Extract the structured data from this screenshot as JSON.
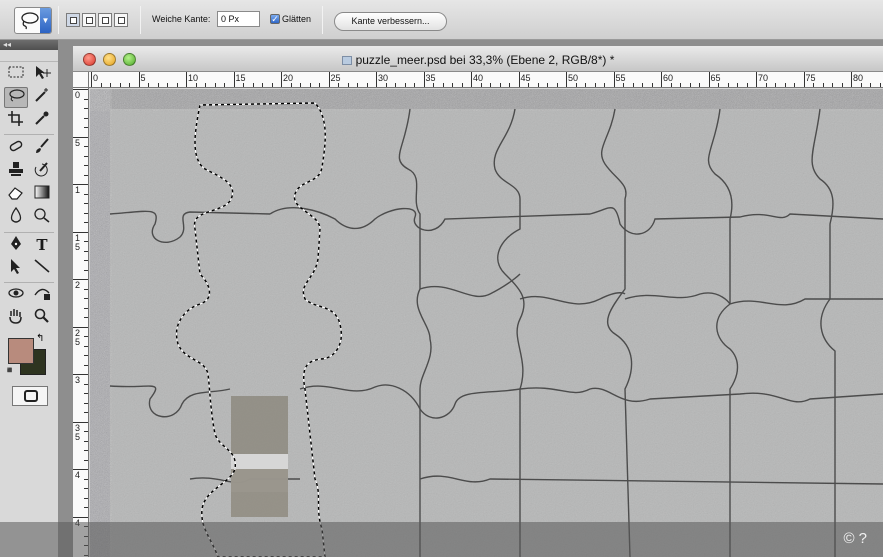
{
  "options_bar": {
    "tool_icon": "lasso-icon",
    "feather_label": "Weiche Kante:",
    "feather_value": "0 Px",
    "antialias_label": "Glätten",
    "antialias_checked": true,
    "refine_edge_label": "Kante verbessern..."
  },
  "toolbox": {
    "collapse_glyph": "◂◂",
    "tools": [
      "marquee-icon",
      "move-icon",
      "lasso-icon",
      "magic-wand-icon",
      "crop-icon",
      "eyedropper-icon",
      "healing-brush-icon",
      "brush-icon",
      "clone-stamp-icon",
      "history-brush-icon",
      "eraser-icon",
      "gradient-icon",
      "blur-icon",
      "dodge-icon",
      "pen-icon",
      "type-icon",
      "path-selection-icon",
      "line-icon",
      "3d-rotate-icon",
      "3d-orbit-icon",
      "hand-icon",
      "zoom-icon"
    ],
    "type_glyph": "T",
    "foreground_color": "#b88b7d",
    "background_color": "#2e3420"
  },
  "document": {
    "title": "puzzle_meer.psd bei 33,3% (Ebene 2, RGB/8*) *",
    "ruler_h_labels": [
      "0",
      "5",
      "10",
      "15",
      "20",
      "25",
      "30",
      "35",
      "40",
      "45",
      "50",
      "55",
      "60",
      "65",
      "70",
      "75",
      "80"
    ],
    "ruler_v_labels": [
      "0",
      "5",
      "1",
      "1\n5",
      "2",
      "2\n5",
      "3",
      "3\n5",
      "4",
      "4"
    ]
  },
  "overlay": {
    "copyright": "© ?"
  }
}
